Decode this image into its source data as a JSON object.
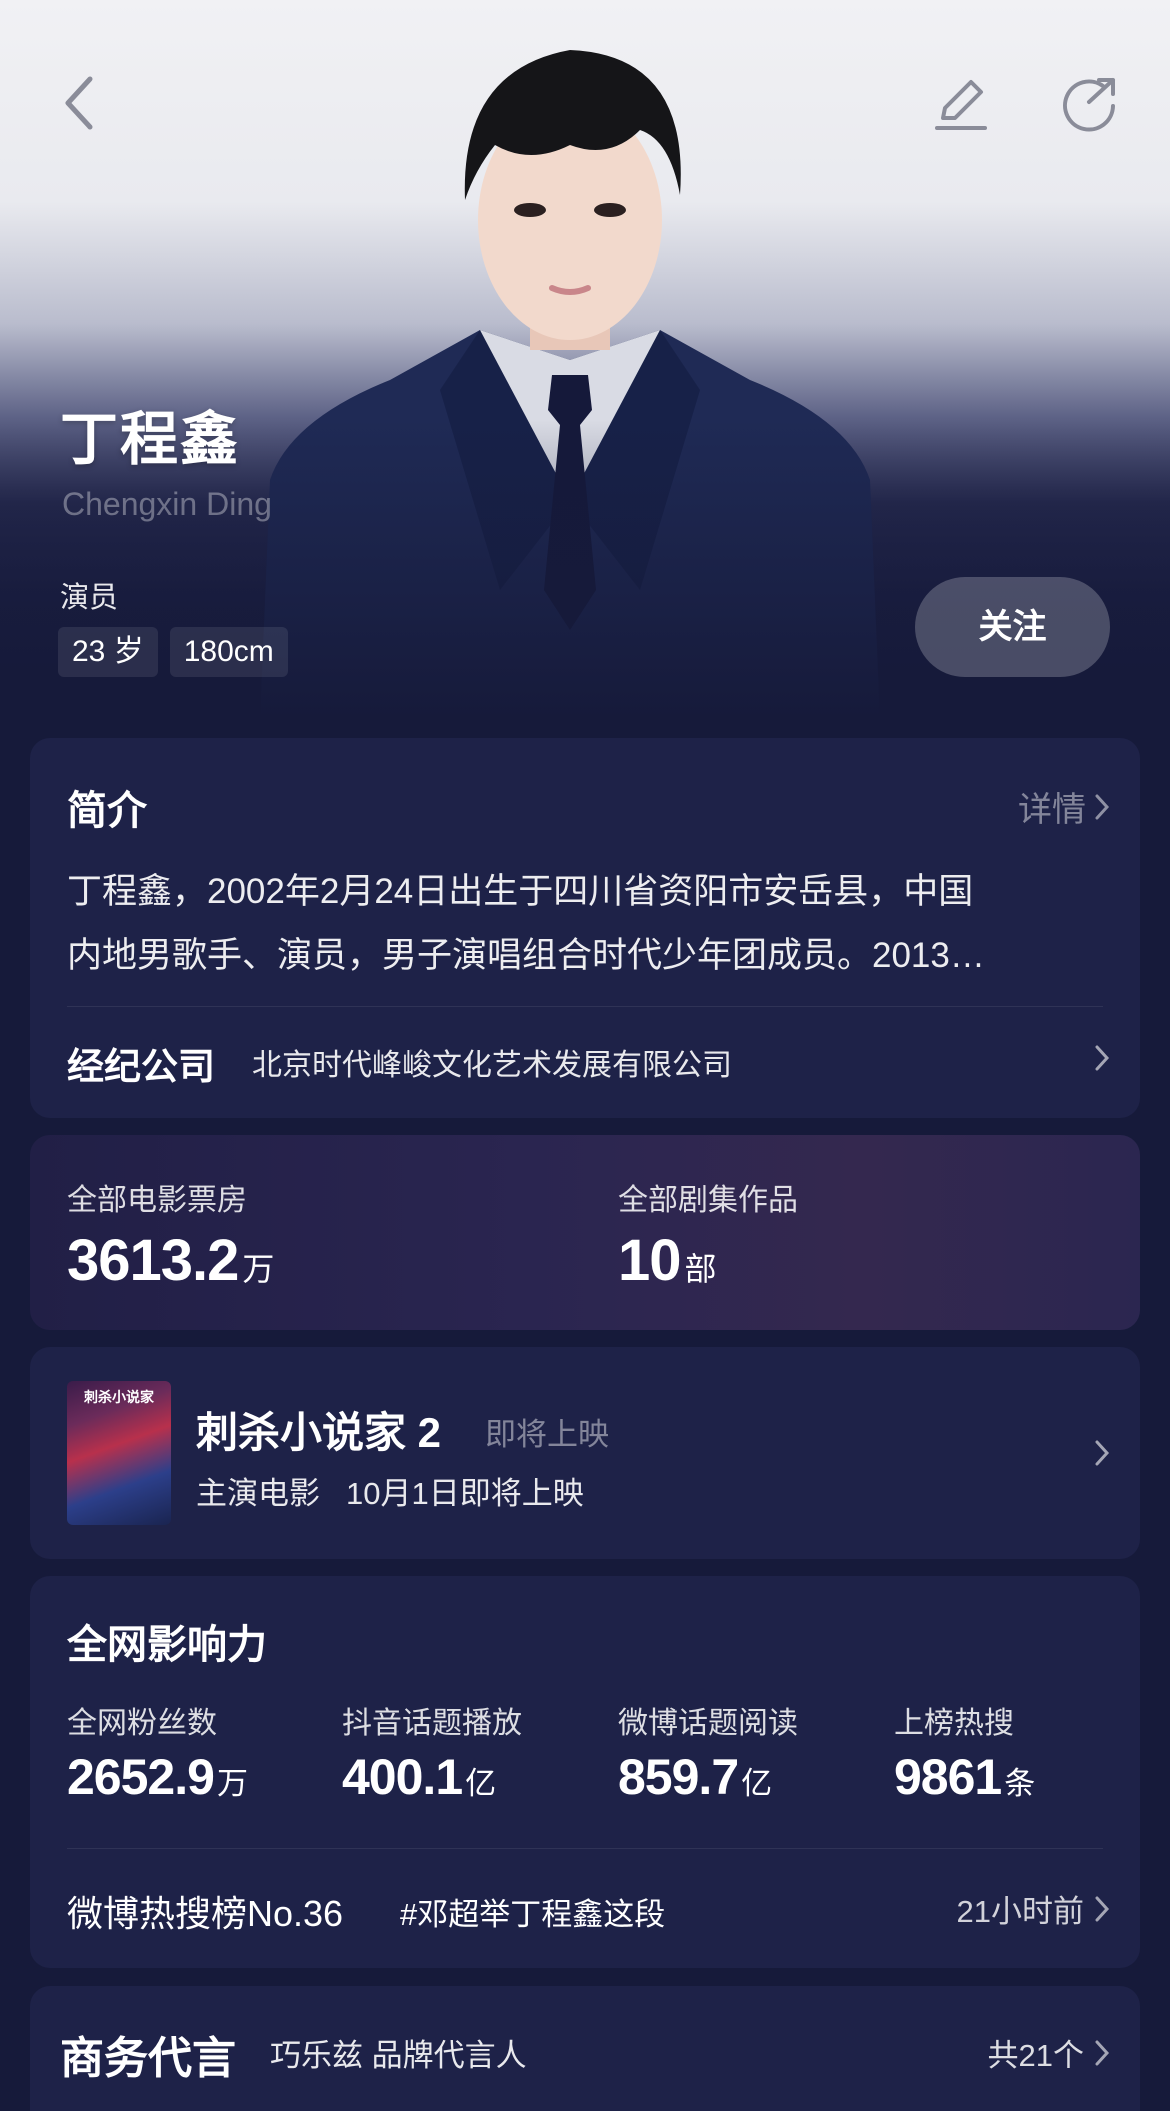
{
  "header": {
    "name": "丁程鑫",
    "name_en": "Chengxin Ding",
    "role": "演员",
    "tags": [
      "23 岁",
      "180cm"
    ],
    "follow_label": "关注",
    "icons": [
      "back-arrow-icon",
      "edit-pencil-icon",
      "share-icon"
    ]
  },
  "intro": {
    "title": "简介",
    "detail_label": "详情",
    "text_line1": "丁程鑫，2002年2月24日出生于四川省资阳市安岳县，中国",
    "text_line2": "内地男歌手、演员，男子演唱组合时代少年团成员。2013…",
    "agency_label": "经纪公司",
    "agency_value": "北京时代峰峻文化艺术发展有限公司"
  },
  "stats": {
    "box_office_label": "全部电影票房",
    "box_office_value": "3613.2",
    "box_office_unit": "万",
    "series_label": "全部剧集作品",
    "series_value": "10",
    "series_unit": "部"
  },
  "movie": {
    "poster_text": "刺杀小说家",
    "title": "刺杀小说家 2",
    "status": "即将上映",
    "role_label": "主演电影",
    "release": "10月1日即将上映"
  },
  "influence": {
    "title": "全网影响力",
    "metrics": [
      {
        "label": "全网粉丝数",
        "value": "2652.9",
        "unit": "万"
      },
      {
        "label": "抖音话题播放",
        "value": "400.1",
        "unit": "亿"
      },
      {
        "label": "微博话题阅读",
        "value": "859.7",
        "unit": "亿"
      },
      {
        "label": "上榜热搜",
        "value": "9861",
        "unit": "条"
      }
    ],
    "hot_rank": "微博热搜榜No.36",
    "hot_topic": "#邓超举丁程鑫这段",
    "hot_time": "21小时前"
  },
  "endorse": {
    "title": "商务代言",
    "brand": "巧乐兹  品牌代言人",
    "count": "共21个"
  },
  "colors": {
    "background": "#161a3a",
    "card": "#1e2248",
    "follow_button": "#3d4066"
  }
}
